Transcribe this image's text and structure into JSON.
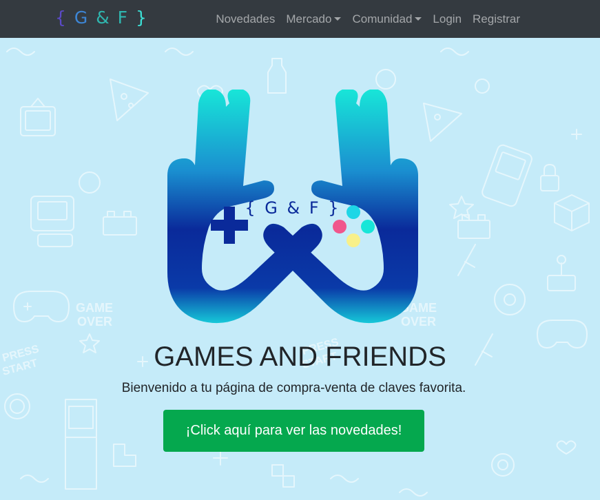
{
  "navbar": {
    "brand": {
      "open": "{",
      "g": "G",
      "amp": "&",
      "f": "F",
      "close": "}"
    },
    "links": [
      {
        "label": "Novedades",
        "dropdown": false
      },
      {
        "label": "Mercado",
        "dropdown": true
      },
      {
        "label": "Comunidad",
        "dropdown": true
      },
      {
        "label": "Login",
        "dropdown": false
      },
      {
        "label": "Registrar",
        "dropdown": false
      }
    ]
  },
  "hero": {
    "logo_text": "{ G & F }",
    "title": "GAMES AND FRIENDS",
    "subtitle": "Bienvenido a tu página de compra-venta de claves favorita.",
    "cta_label": "¡Click aquí para ver las novedades!",
    "pattern_texts": [
      "GAME",
      "OVER",
      "PRESS",
      "START"
    ]
  },
  "colors": {
    "navbar_bg": "#343a40",
    "hero_bg": "#c5ebf9",
    "cta_bg": "#05a84e",
    "logo_dark_blue": "#0a2a9a",
    "logo_cyan": "#18e6d8",
    "button_cyan": "#1ed6e6",
    "button_pink": "#f0568c",
    "button_yellow": "#f8f08a"
  },
  "icons": [
    "gamepad-icon",
    "dpad-icon",
    "tv-icon",
    "pizza-icon",
    "joystick-icon",
    "handheld-console-icon"
  ]
}
